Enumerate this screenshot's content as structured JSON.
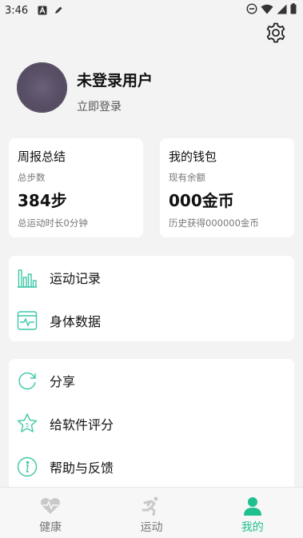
{
  "status_bar": {
    "time": "3:46",
    "left_icons": [
      "a-notification-icon",
      "pen-icon"
    ],
    "right_icons": [
      "dnd-icon",
      "wifi-icon",
      "signal-icon",
      "battery-icon"
    ]
  },
  "header": {
    "settings_icon": "gear-icon"
  },
  "profile": {
    "name": "未登录用户",
    "login_link": "立即登录"
  },
  "weekly_card": {
    "title": "周报总结",
    "steps_label": "总步数",
    "steps_value": "384步",
    "duration_text": "总运动时长0分钟"
  },
  "wallet_card": {
    "title": "我的钱包",
    "balance_label": "现有余额",
    "balance_value": "000金币",
    "history_text": "历史获得000000金币"
  },
  "list_group_1": [
    {
      "label": "运动记录",
      "icon": "bar-chart-icon"
    },
    {
      "label": "身体数据",
      "icon": "heart-monitor-icon"
    }
  ],
  "list_group_2": [
    {
      "label": "分享",
      "icon": "share-icon"
    },
    {
      "label": "给软件评分",
      "icon": "star-rating-icon"
    },
    {
      "label": "帮助与反馈",
      "icon": "info-icon"
    }
  ],
  "bottom_nav": [
    {
      "label": "健康",
      "icon": "heart-pulse-icon",
      "active": false
    },
    {
      "label": "运动",
      "icon": "running-icon",
      "active": false
    },
    {
      "label": "我的",
      "icon": "person-icon",
      "active": true
    }
  ],
  "colors": {
    "accent": "#1fbf8f",
    "icon_teal": "#3cc7a7",
    "background": "#f3f3f3",
    "card": "#ffffff"
  }
}
